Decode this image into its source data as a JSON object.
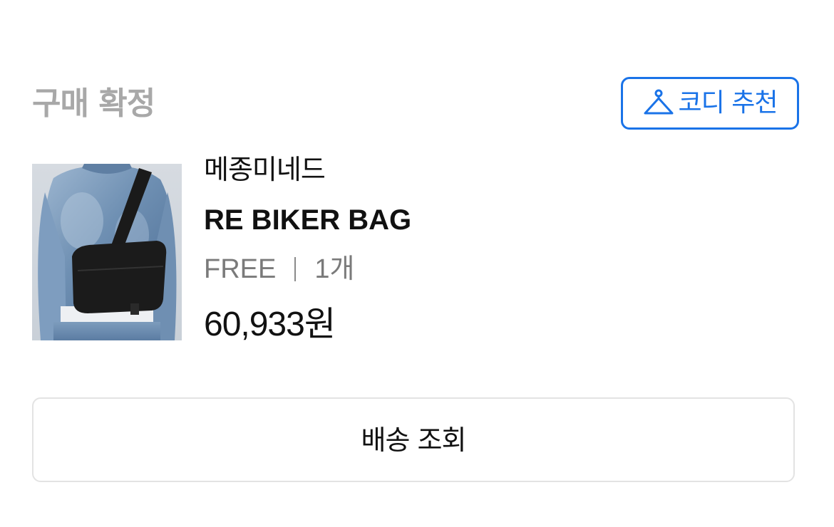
{
  "order": {
    "status": "구매 확정",
    "codi_button": {
      "label": "코디 추천",
      "icon": "hanger-icon",
      "color": "#1a73e8"
    },
    "product": {
      "image": "product-thumbnail",
      "brand": "메종미네드",
      "name": "RE BIKER BAG",
      "option": "FREE",
      "quantity": "1개",
      "price": "60,933원"
    },
    "track_button": {
      "label": "배송 조회"
    }
  }
}
